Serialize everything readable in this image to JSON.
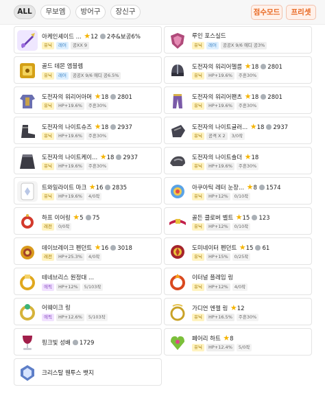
{
  "filters": {
    "tabs": [
      "ALL",
      "무보엠",
      "방어구",
      "장신구"
    ],
    "score_mode": "점수모드",
    "preset": "프리셋"
  },
  "items": [
    {
      "name": "아케인셰이드 ...",
      "star": "12",
      "pot": "2추&보공6%",
      "tags": [
        "유닉",
        "레어",
        "공XX 9"
      ]
    },
    {
      "name": "루인 포스실드",
      "tags": [
        "유닉",
        "레어",
        "공공X 9/6 에디 공3%"
      ]
    },
    {
      "name": "골드 데몬 엠블렘",
      "tags": [
        "유닉",
        "레어",
        "공공X 9/6 에디 공6.5%"
      ]
    },
    {
      "name": "도전자의 워리어헬름",
      "star": "18",
      "pot": "2801",
      "tags": [
        "유닉",
        "HP+19.6%",
        "주흔30%"
      ]
    },
    {
      "name": "도전자의 워리어아머",
      "star": "18",
      "pot": "2801",
      "tags": [
        "유닉",
        "HP+19.6%",
        "주흔30%"
      ]
    },
    {
      "name": "도전자의 워리어팬츠",
      "star": "18",
      "pot": "2801",
      "tags": [
        "유닉",
        "HP+19.6%",
        "주흔30%"
      ]
    },
    {
      "name": "도전자의 나이트슈즈",
      "star": "18",
      "pot": "2937",
      "tags": [
        "유닉",
        "HP+19.6%",
        "주흔30%"
      ]
    },
    {
      "name": "도전자의 나이트글러...",
      "star": "18",
      "pot": "2937",
      "tags": [
        "유닉",
        "공격 X 2",
        "3/0작"
      ]
    },
    {
      "name": "도전자의 나이트케이...",
      "star": "18",
      "pot": "2937",
      "tags": [
        "유닉",
        "HP+19.6%",
        "주흔30%"
      ]
    },
    {
      "name": "도전자의 나이트숄더",
      "star": "18",
      "tags": [
        "유닉",
        "HP+19.6%",
        "주흔30%"
      ]
    },
    {
      "name": "트와일라이트 마크",
      "star": "16",
      "pot": "2835",
      "tags": [
        "유닉",
        "HP+19.6%",
        "4/0작"
      ]
    },
    {
      "name": "아쿠아틱 레터 눈장...",
      "star": "8",
      "pot": "1574",
      "tags": [
        "유닉",
        "HP+12%",
        "0/10작"
      ]
    },
    {
      "name": "하프 이어링",
      "star": "5",
      "pot": "75",
      "tags": [
        "레전",
        "0/0작"
      ]
    },
    {
      "name": "골든 클로버 벨트",
      "star": "15",
      "pot": "123",
      "tags": [
        "유닉",
        "HP+12%",
        "0/10작"
      ]
    },
    {
      "name": "데이브레이크 펜던트",
      "star": "16",
      "pot": "3018",
      "tags": [
        "레전",
        "HP+25.3%",
        "4/0작"
      ]
    },
    {
      "name": "도미네이터 펜던트",
      "star": "15",
      "pot": "61",
      "tags": [
        "유닉",
        "HP+15%",
        "0/25작"
      ]
    },
    {
      "name": "테네브리스 원정대 ...",
      "tags": [
        "에픽",
        "HP+12%",
        "5/103작"
      ]
    },
    {
      "name": "이터널 플레임 링",
      "tags": [
        "유닉",
        "HP+12%",
        "4/0작"
      ]
    },
    {
      "name": "어웨이크 링",
      "tags": [
        "에픽",
        "HP+12.6%",
        "5/103작"
      ]
    },
    {
      "name": "가디언 엔젤 링",
      "star": "12",
      "tags": [
        "유닉",
        "HP+16.5%",
        "주흔30%"
      ]
    },
    {
      "name": "핑크빛 성배",
      "pot": "1729",
      "tags": []
    },
    {
      "name": "페어리 하트",
      "star": "8",
      "tags": [
        "유닉",
        "HP+12.4%",
        "5/0작"
      ]
    },
    {
      "name": "크리스탈 웬투스 뱃지",
      "tags": []
    }
  ],
  "icons": [
    "sword-icon",
    "shield-icon",
    "emblem-icon",
    "helmet-icon",
    "armor-icon",
    "pants-icon",
    "shoes-icon",
    "gloves-icon",
    "cape-icon",
    "shoulder-icon",
    "badge-mark-icon",
    "eye-accessory-icon",
    "earring-icon",
    "belt-icon",
    "pendant-icon",
    "pendant-red-icon",
    "ring-gold-icon",
    "ring-red-icon",
    "ring-green-icon",
    "ring-angel-icon",
    "chalice-icon",
    "fairy-heart-icon",
    "badge-crystal-icon"
  ]
}
